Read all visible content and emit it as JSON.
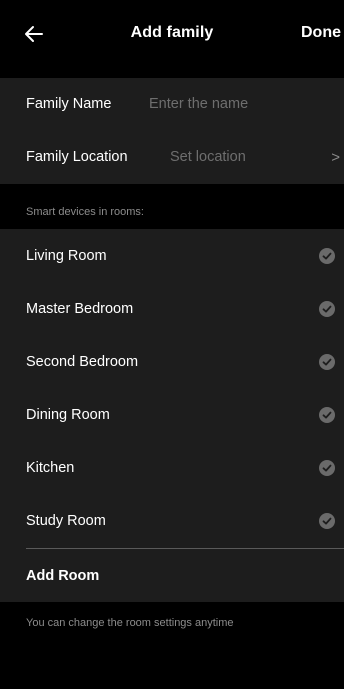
{
  "header": {
    "back_icon": "arrow-left-icon",
    "title": "Add family",
    "done_label": "Done"
  },
  "family": {
    "name_label": "Family Name",
    "name_placeholder": "Enter the name",
    "location_label": "Family Location",
    "location_value": "Set location",
    "location_chevron": ">"
  },
  "rooms": {
    "caption": "Smart devices in rooms:",
    "items": [
      {
        "label": "Living Room",
        "checked": true
      },
      {
        "label": "Master Bedroom",
        "checked": true
      },
      {
        "label": "Second Bedroom",
        "checked": true
      },
      {
        "label": "Dining Room",
        "checked": true
      },
      {
        "label": "Kitchen",
        "checked": true
      },
      {
        "label": "Study Room",
        "checked": true
      }
    ],
    "add_label": "Add Room"
  },
  "footer": {
    "note": "You can change the room settings anytime"
  },
  "colors": {
    "background": "#000000",
    "card": "#1d1d1d",
    "text": "#ffffff",
    "muted_text": "#6e6e6e",
    "check": "#6a6a6a"
  }
}
